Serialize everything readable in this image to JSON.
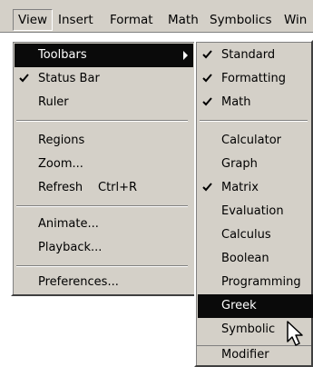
{
  "menubar": {
    "items": [
      {
        "label": "View"
      },
      {
        "label": "Insert"
      },
      {
        "label": "Format"
      },
      {
        "label": "Math"
      },
      {
        "label": "Symbolics"
      },
      {
        "label": "Win"
      }
    ]
  },
  "view_menu": {
    "items": [
      {
        "label": "Toolbars",
        "has_submenu": true,
        "checked": false
      },
      {
        "label": "Status Bar",
        "checked": true
      },
      {
        "label": "Ruler",
        "checked": false
      },
      {
        "label": "Regions"
      },
      {
        "label": "Zoom..."
      },
      {
        "label": "Refresh",
        "shortcut": "Ctrl+R"
      },
      {
        "label": "Animate..."
      },
      {
        "label": "Playback..."
      },
      {
        "label": "Preferences..."
      }
    ]
  },
  "toolbars_submenu": {
    "items": [
      {
        "label": "Standard",
        "checked": true
      },
      {
        "label": "Formatting",
        "checked": true
      },
      {
        "label": "Math",
        "checked": true
      },
      {
        "label": "Calculator",
        "checked": false
      },
      {
        "label": "Graph",
        "checked": false
      },
      {
        "label": "Matrix",
        "checked": true
      },
      {
        "label": "Evaluation",
        "checked": false
      },
      {
        "label": "Calculus",
        "checked": false
      },
      {
        "label": "Boolean",
        "checked": false
      },
      {
        "label": "Programming",
        "checked": false
      },
      {
        "label": "Greek",
        "checked": false,
        "highlighted": true
      },
      {
        "label": "Symbolic",
        "checked": false
      },
      {
        "label": "Modifier",
        "checked": false
      }
    ]
  },
  "colors": {
    "menu_bg": "#d4d0c8",
    "highlight_bg": "#0a0a0a",
    "highlight_fg": "#ffffff"
  },
  "icons": {
    "submenu_arrow": "arrow-right-icon",
    "check": "checkmark-icon",
    "cursor": "mouse-pointer-icon"
  }
}
